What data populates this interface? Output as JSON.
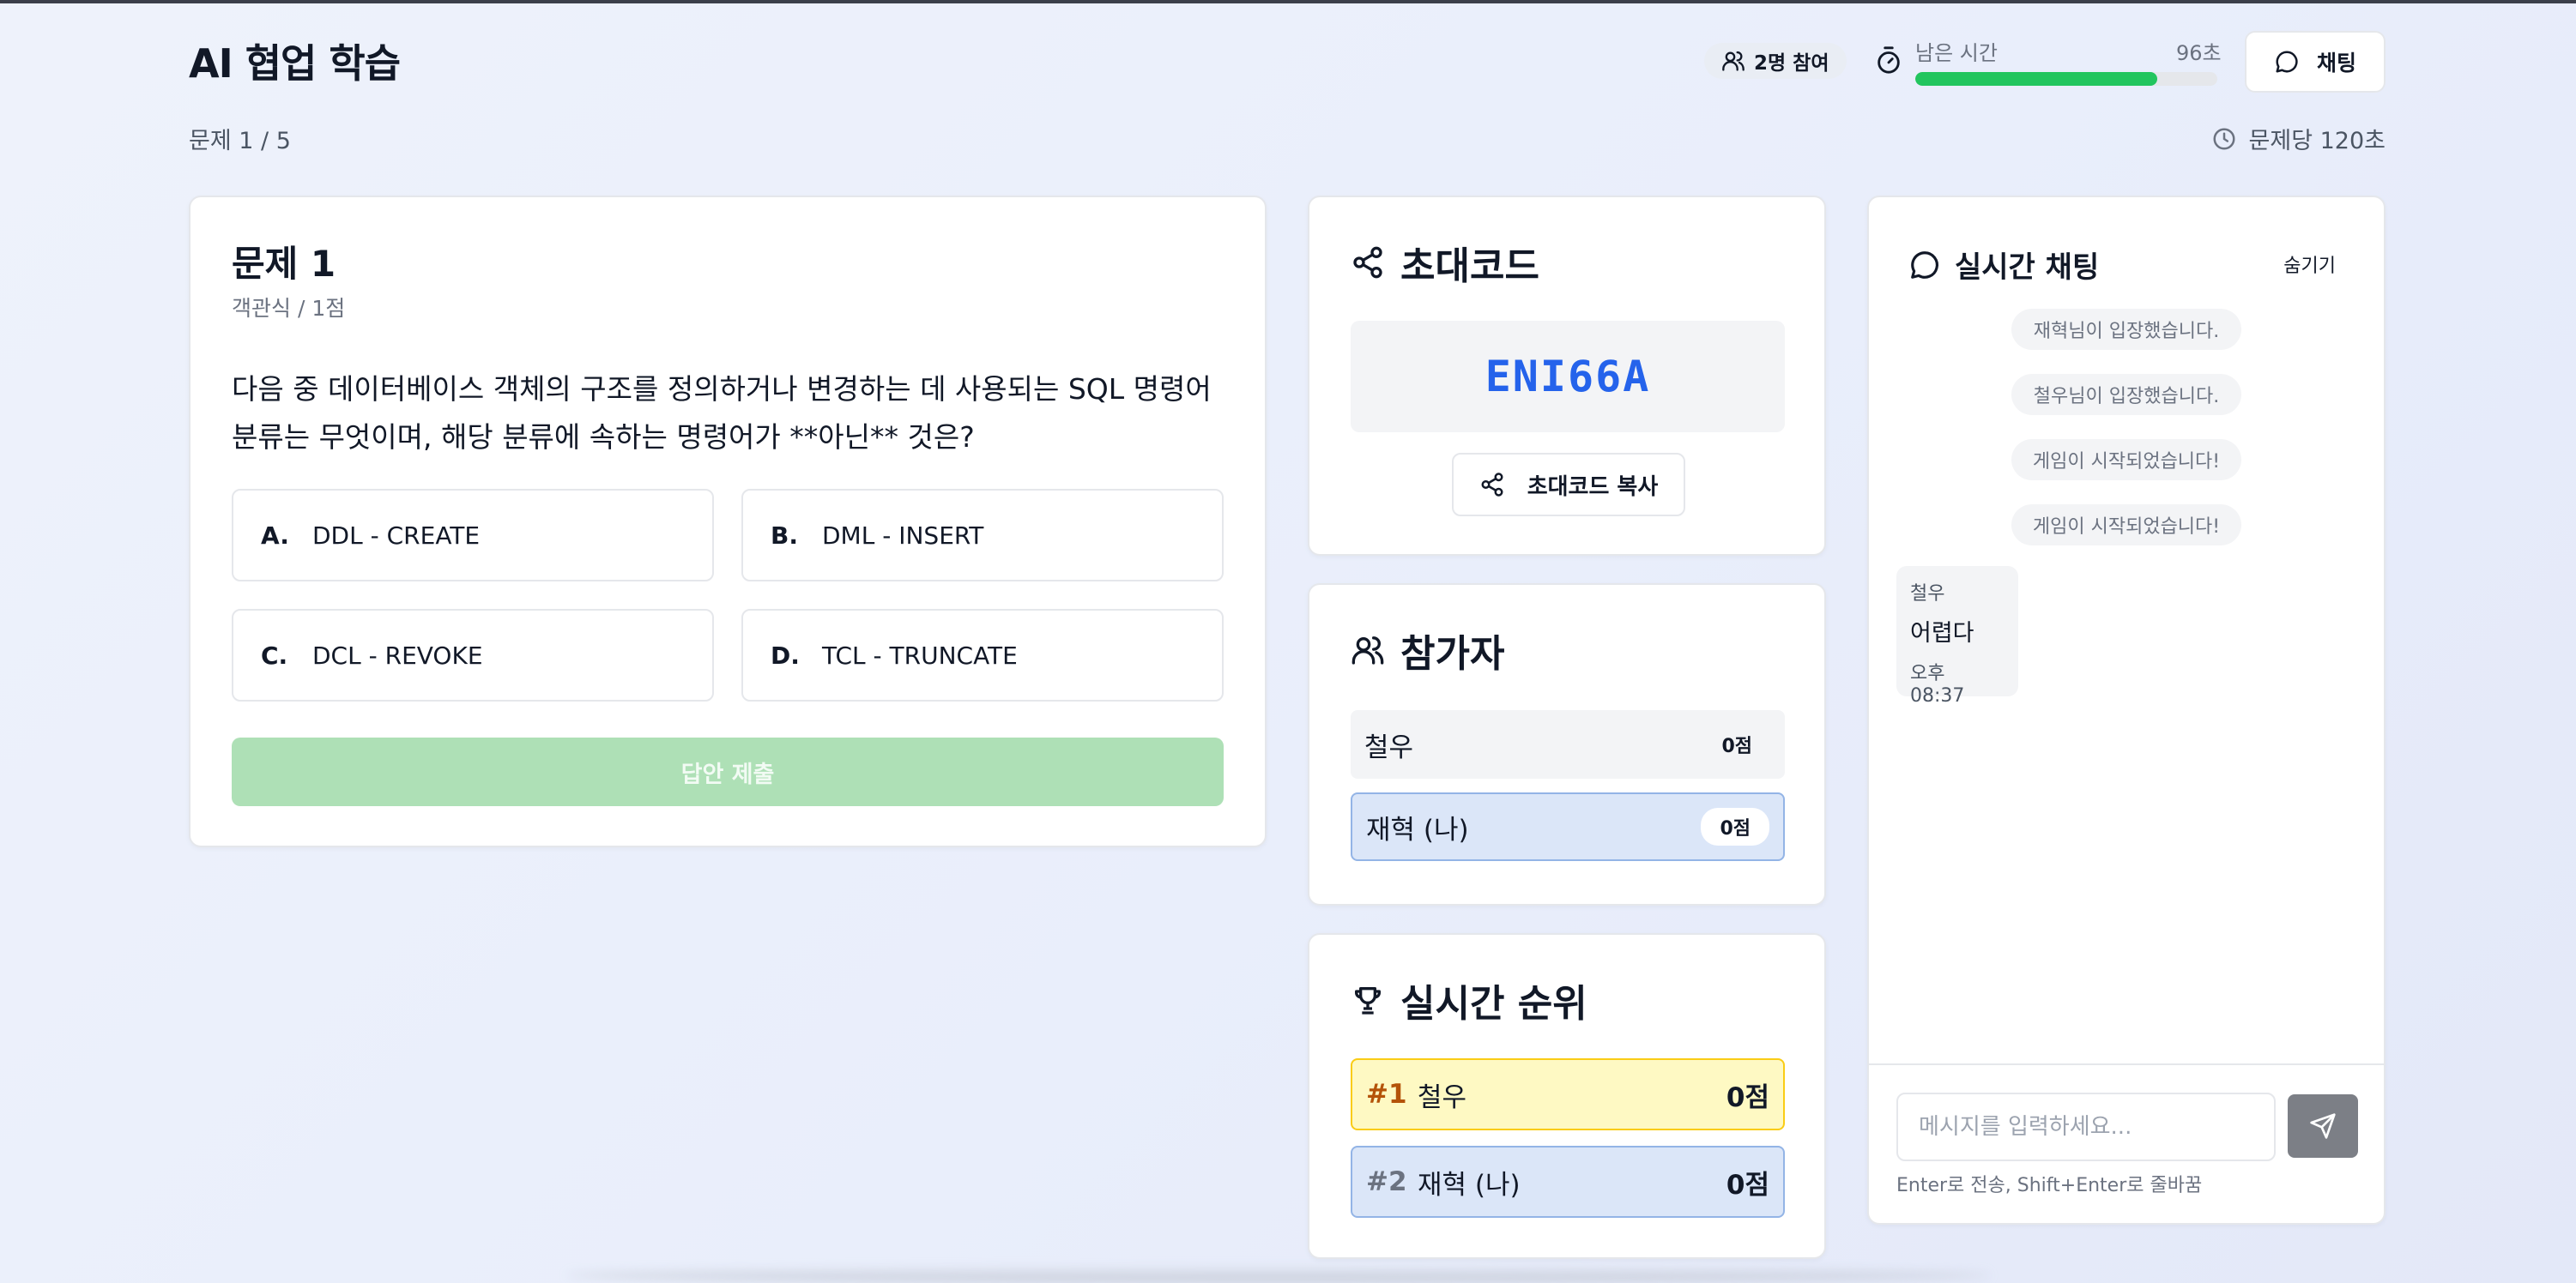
{
  "header": {
    "app_title": "AI 협업 학습",
    "question_progress": "문제 1 / 5",
    "participants_label": "2명 참여",
    "timer_label": "남은 시간",
    "timer_value": "96초",
    "timer_fraction": 0.8,
    "chat_button_label": "채팅",
    "per_question_label": "문제당 120초"
  },
  "question": {
    "title": "문제 1",
    "meta": "객관식 / 1점",
    "text": "다음 중 데이터베이스 객체의 구조를 정의하거나 변경하는 데 사용되는 SQL 명령어 분류는 무엇이며, 해당 분류에 속하는 명령어가 **아닌** 것은?",
    "options": [
      {
        "letter": "A.",
        "text": "DDL - CREATE"
      },
      {
        "letter": "B.",
        "text": "DML - INSERT"
      },
      {
        "letter": "C.",
        "text": "DCL - REVOKE"
      },
      {
        "letter": "D.",
        "text": "TCL - TRUNCATE"
      }
    ],
    "submit_label": "답안 제출"
  },
  "invite": {
    "title": "초대코드",
    "code": "ENI66A",
    "copy_label": "초대코드 복사"
  },
  "players": {
    "title": "참가자",
    "list": [
      {
        "name": "철우",
        "score": "0점"
      },
      {
        "name": "재혁 (나)",
        "score": "0점"
      }
    ]
  },
  "ranking": {
    "title": "실시간 순위",
    "list": [
      {
        "rank": "#1",
        "name": "철우",
        "score": "0점"
      },
      {
        "rank": "#2",
        "name": "재혁 (나)",
        "score": "0점"
      }
    ]
  },
  "chat": {
    "title": "실시간 채팅",
    "hide_label": "숨기기",
    "system_messages": [
      "재혁님이 입장했습니다.",
      "철우님이 입장했습니다.",
      "게임이 시작되었습니다!",
      "게임이 시작되었습니다!"
    ],
    "message": {
      "sender": "철우",
      "text": "어렵다",
      "time": "오후 08:37"
    },
    "input_placeholder": "메시지를 입력하세요...",
    "hint": "Enter로 전송, Shift+Enter로 줄바꿈"
  },
  "colors": {
    "accent_green": "#22c55e",
    "submit_disabled": "#aee0b6",
    "invite_code_blue": "#2563eb",
    "rank1_bg": "#fef9c3",
    "me_bg": "#dbe6f8"
  }
}
